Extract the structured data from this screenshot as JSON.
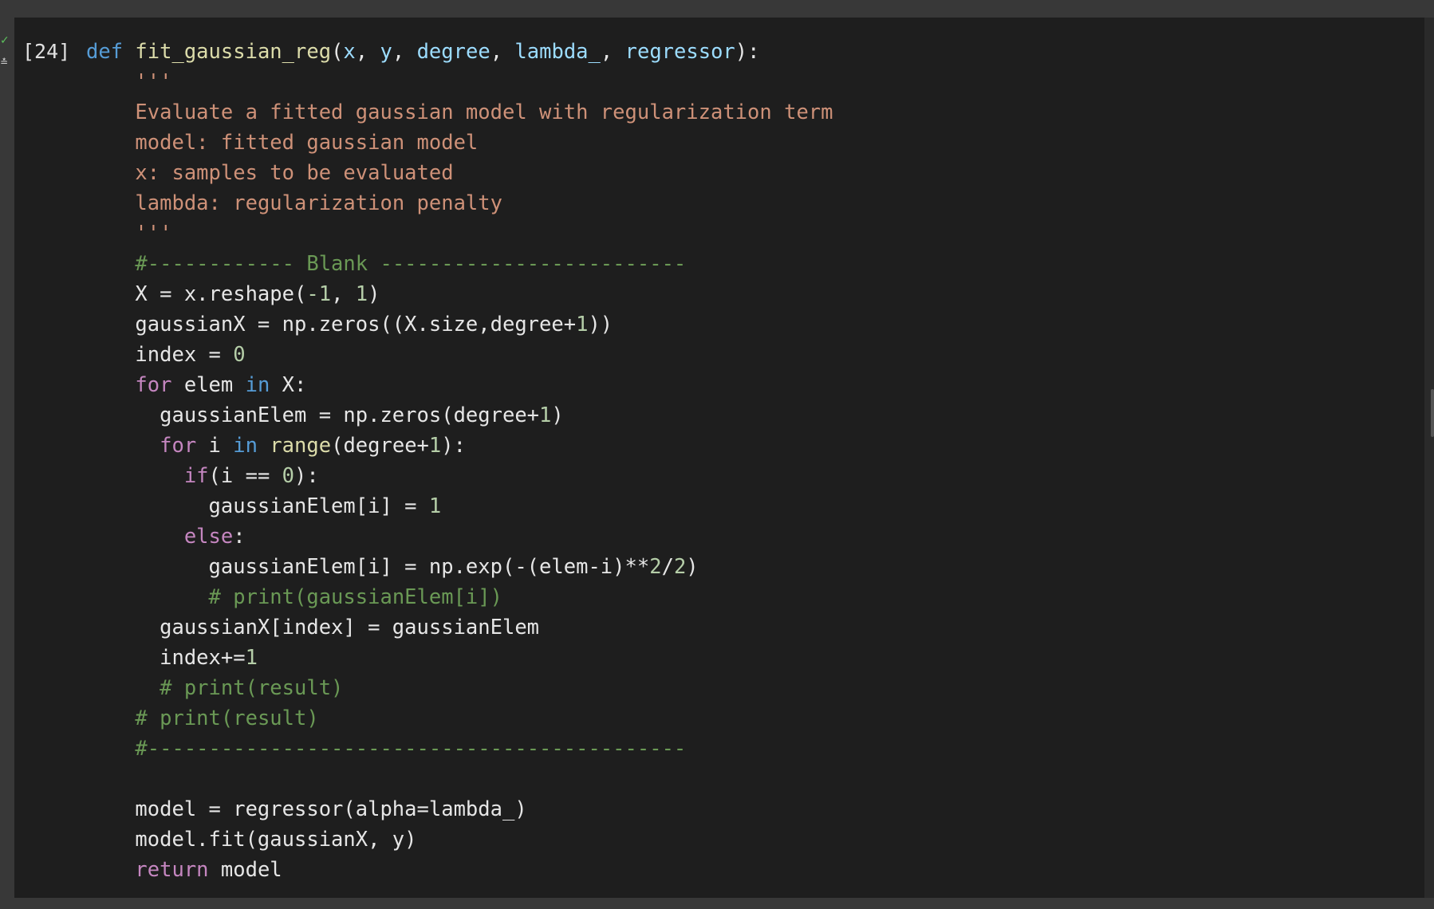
{
  "cell": {
    "execution_count": "[24]",
    "status_check": "✓",
    "status_glyph": "≛",
    "lines": [
      [
        [
          "kw",
          "def"
        ],
        [
          "plain",
          " "
        ],
        [
          "fn",
          "fit_gaussian_reg"
        ],
        [
          "plain",
          "("
        ],
        [
          "param",
          "x"
        ],
        [
          "plain",
          ", "
        ],
        [
          "param",
          "y"
        ],
        [
          "plain",
          ", "
        ],
        [
          "param",
          "degree"
        ],
        [
          "plain",
          ", "
        ],
        [
          "param",
          "lambda_"
        ],
        [
          "plain",
          ", "
        ],
        [
          "param",
          "regressor"
        ],
        [
          "plain",
          "):"
        ]
      ],
      [
        [
          "plain",
          "    "
        ],
        [
          "str",
          "'''"
        ]
      ],
      [
        [
          "plain",
          "    "
        ],
        [
          "str",
          "Evaluate a fitted gaussian model with regularization term"
        ]
      ],
      [
        [
          "plain",
          "    "
        ],
        [
          "str",
          "model: fitted gaussian model"
        ]
      ],
      [
        [
          "plain",
          "    "
        ],
        [
          "str",
          "x: samples to be evaluated"
        ]
      ],
      [
        [
          "plain",
          "    "
        ],
        [
          "str",
          "lambda: regularization penalty"
        ]
      ],
      [
        [
          "plain",
          "    "
        ],
        [
          "str",
          "'''"
        ]
      ],
      [
        [
          "plain",
          "    "
        ],
        [
          "cmt",
          "#------------ Blank -------------------------"
        ]
      ],
      [
        [
          "plain",
          "    X = x.reshape("
        ],
        [
          "num",
          "-1"
        ],
        [
          "plain",
          ", "
        ],
        [
          "num",
          "1"
        ],
        [
          "plain",
          ")"
        ]
      ],
      [
        [
          "plain",
          "    gaussianX = np.zeros((X.size,degree+"
        ],
        [
          "num",
          "1"
        ],
        [
          "plain",
          "))"
        ]
      ],
      [
        [
          "plain",
          "    index = "
        ],
        [
          "num",
          "0"
        ]
      ],
      [
        [
          "plain",
          "    "
        ],
        [
          "ctl",
          "for"
        ],
        [
          "plain",
          " elem "
        ],
        [
          "kw",
          "in"
        ],
        [
          "plain",
          " X:"
        ]
      ],
      [
        [
          "plain",
          "      gaussianElem = np.zeros(degree+"
        ],
        [
          "num",
          "1"
        ],
        [
          "plain",
          ")"
        ]
      ],
      [
        [
          "plain",
          "      "
        ],
        [
          "ctl",
          "for"
        ],
        [
          "plain",
          " i "
        ],
        [
          "kw",
          "in"
        ],
        [
          "plain",
          " "
        ],
        [
          "fn",
          "range"
        ],
        [
          "plain",
          "(degree+"
        ],
        [
          "num",
          "1"
        ],
        [
          "plain",
          "):"
        ]
      ],
      [
        [
          "plain",
          "        "
        ],
        [
          "ctl",
          "if"
        ],
        [
          "plain",
          "(i == "
        ],
        [
          "num",
          "0"
        ],
        [
          "plain",
          "):"
        ]
      ],
      [
        [
          "plain",
          "          gaussianElem[i] = "
        ],
        [
          "num",
          "1"
        ]
      ],
      [
        [
          "plain",
          "        "
        ],
        [
          "ctl",
          "else"
        ],
        [
          "plain",
          ":"
        ]
      ],
      [
        [
          "plain",
          "          gaussianElem[i] = np.exp(-(elem-i)**"
        ],
        [
          "num",
          "2"
        ],
        [
          "plain",
          "/"
        ],
        [
          "num",
          "2"
        ],
        [
          "plain",
          ")"
        ]
      ],
      [
        [
          "plain",
          "          "
        ],
        [
          "cmt",
          "# print(gaussianElem[i])"
        ]
      ],
      [
        [
          "plain",
          "      gaussianX[index] = gaussianElem"
        ]
      ],
      [
        [
          "plain",
          "      index+="
        ],
        [
          "num",
          "1"
        ]
      ],
      [
        [
          "plain",
          "      "
        ],
        [
          "cmt",
          "# print(result)"
        ]
      ],
      [
        [
          "plain",
          "    "
        ],
        [
          "cmt",
          "# print(result)"
        ]
      ],
      [
        [
          "plain",
          "    "
        ],
        [
          "cmt",
          "#--------------------------------------------"
        ]
      ],
      [
        [
          "plain",
          ""
        ]
      ],
      [
        [
          "plain",
          "    model = regressor(alpha=lambda_)"
        ]
      ],
      [
        [
          "plain",
          "    model.fit(gaussianX, y)"
        ]
      ],
      [
        [
          "plain",
          "    "
        ],
        [
          "ctl",
          "return"
        ],
        [
          "plain",
          " model"
        ]
      ]
    ]
  },
  "colors": {
    "background": "#383838",
    "cell_background": "#1e1e1e",
    "keyword": "#569cd6",
    "control": "#c586c0",
    "function": "#dcdcaa",
    "parameter": "#9cdcfe",
    "string": "#ce9178",
    "number": "#b5cea8",
    "comment": "#6a9955",
    "text": "#e6e6e6"
  }
}
